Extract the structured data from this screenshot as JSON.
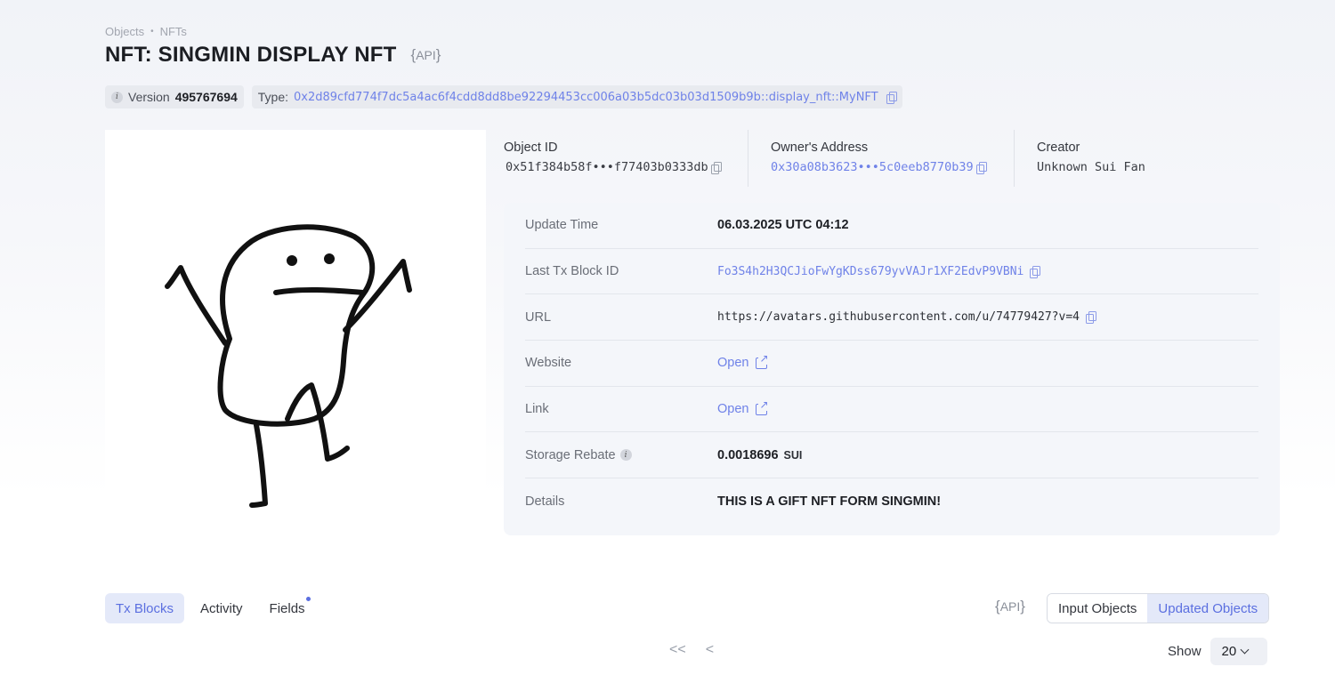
{
  "breadcrumb": {
    "items": [
      "Objects",
      "NFTs"
    ],
    "separator": "•"
  },
  "page": {
    "title": "NFT: SINGMIN DISPLAY NFT",
    "api_label": "API"
  },
  "meta": {
    "version_label": "Version",
    "version_value": "495767694",
    "type_label": "Type:",
    "type_value": "0x2d89cfd774f7dc5a4ac6f4cdd8dd8be92294453cc006a03b5dc03b03d1509b9b::display_nft::MyNFT"
  },
  "info": {
    "object_id_label": "Object ID",
    "object_id_value": "0x51f384b58f•••f77403b0333db",
    "owner_label": "Owner's Address",
    "owner_value": "0x30a08b3623•••5c0eeb8770b39",
    "creator_label": "Creator",
    "creator_value": "Unknown Sui Fan"
  },
  "details": {
    "update_time_label": "Update Time",
    "update_time_value": "06.03.2025 UTC 04:12",
    "last_tx_label": "Last Tx Block ID",
    "last_tx_value": "Fo3S4h2H3QCJioFwYgKDss679yvVAJr1XF2EdvP9VBNi",
    "url_label": "URL",
    "url_value": "https://avatars.githubusercontent.com/u/74779427?v=4",
    "website_label": "Website",
    "website_value": "Open",
    "link_label": "Link",
    "link_value": "Open",
    "storage_label": "Storage Rebate",
    "storage_value": "0.0018696",
    "storage_unit": "SUI",
    "details_label": "Details",
    "details_value": "THIS IS A GIFT NFT FORM SINGMIN!"
  },
  "tabs": [
    "Tx Blocks",
    "Activity",
    "Fields"
  ],
  "active_tab": "Tx Blocks",
  "api_right_label": "API",
  "segments": [
    "Input Objects",
    "Updated Objects"
  ],
  "active_segment": "Updated Objects",
  "pagination": {
    "first": "<<",
    "prev": "<"
  },
  "show": {
    "label": "Show",
    "value": "20"
  },
  "colors": {
    "accent": "#5b6fe0",
    "link": "#6f82e8",
    "card": "#f4f6fa"
  },
  "icons": [
    "info-icon",
    "copy-icon",
    "external-link-icon",
    "chevron-down-icon"
  ]
}
